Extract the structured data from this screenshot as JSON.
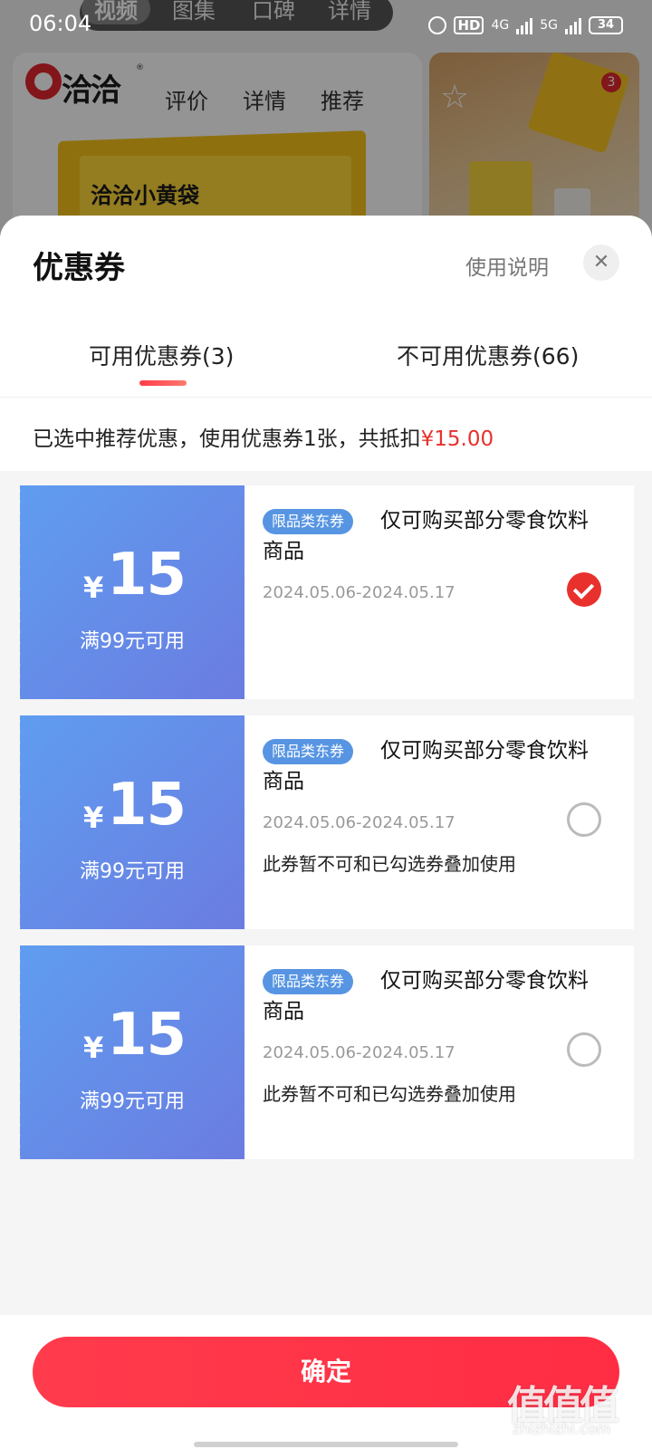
{
  "status_bar": {
    "time": "06:04",
    "network_1": "4G",
    "network_2": "5G",
    "battery": "34"
  },
  "background": {
    "media_tabs": [
      "视频",
      "图集",
      "口碑",
      "详情"
    ],
    "brand": "洽洽",
    "nav": [
      "评价",
      "详情",
      "推荐"
    ],
    "product_text": "洽洽小黄袋",
    "cart_count": "3"
  },
  "sheet": {
    "title": "优惠券",
    "usage_link": "使用说明",
    "close_label": "✕",
    "tabs": [
      {
        "label": "可用优惠券(3)",
        "active": true
      },
      {
        "label": "不可用优惠券(66)",
        "active": false
      }
    ],
    "summary_prefix": "已选中推荐优惠，使用优惠券1张，共抵扣",
    "summary_amount": "¥15.00",
    "coupons": [
      {
        "currency": "¥",
        "amount": "15",
        "condition": "满99元可用",
        "tag": "限品类东券",
        "description": "仅可购买部分零食饮料商品",
        "validity": "2024.05.06-2024.05.17",
        "note": "",
        "selected": true
      },
      {
        "currency": "¥",
        "amount": "15",
        "condition": "满99元可用",
        "tag": "限品类东券",
        "description": "仅可购买部分零食饮料商品",
        "validity": "2024.05.06-2024.05.17",
        "note": "此券暂不可和已勾选券叠加使用",
        "selected": false
      },
      {
        "currency": "¥",
        "amount": "15",
        "condition": "满99元可用",
        "tag": "限品类东券",
        "description": "仅可购买部分零食饮料商品",
        "validity": "2024.05.06-2024.05.17",
        "note": "此券暂不可和已勾选券叠加使用",
        "selected": false
      }
    ],
    "confirm_label": "确定"
  },
  "watermark": {
    "main": "值值值",
    "sub": "zhizhizhi.com"
  },
  "colors": {
    "accent_red": "#e8312d",
    "coupon_blue": "#5f9df0",
    "tag_blue": "#5795e3"
  }
}
